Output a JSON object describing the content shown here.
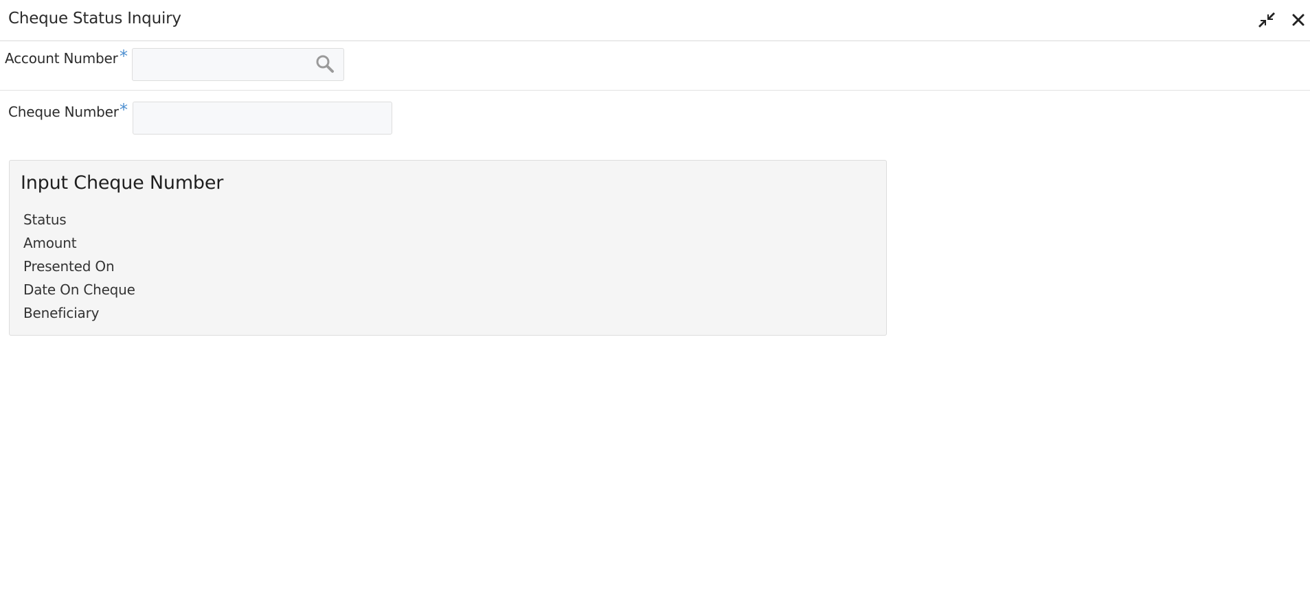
{
  "window": {
    "title": "Cheque Status Inquiry",
    "minimize_icon": "collapse-arrows-icon",
    "close_icon": "close-icon"
  },
  "form": {
    "account_number": {
      "label": "Account Number",
      "required_marker": "*",
      "value": "",
      "placeholder": "",
      "search_icon": "search-icon"
    },
    "cheque_number": {
      "label": "Cheque Number",
      "required_marker": "*",
      "value": "",
      "placeholder": ""
    }
  },
  "results": {
    "title": "Input Cheque Number",
    "rows": [
      {
        "label": "Status"
      },
      {
        "label": "Amount"
      },
      {
        "label": "Presented On"
      },
      {
        "label": "Date On Cheque"
      },
      {
        "label": "Beneficiary"
      }
    ]
  },
  "colors": {
    "required_marker": "#4d8fd0",
    "panel_background": "#f5f5f5",
    "input_background": "#f7f8fa"
  }
}
